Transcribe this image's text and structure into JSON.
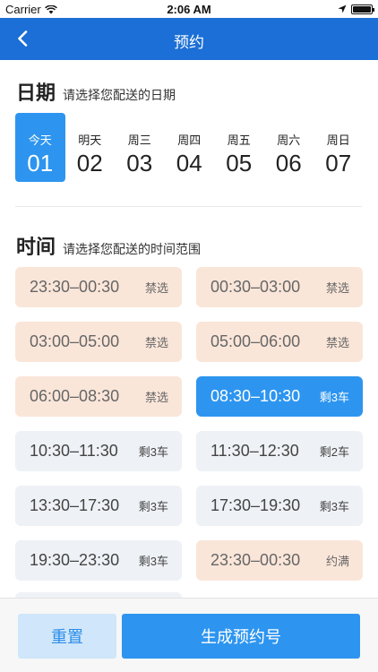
{
  "status_bar": {
    "carrier": "Carrier",
    "time": "2:06 AM"
  },
  "nav": {
    "title": "预约"
  },
  "date_section": {
    "title": "日期",
    "subtitle": "请选择您配送的日期",
    "dates": [
      {
        "label": "今天",
        "day": "01"
      },
      {
        "label": "明天",
        "day": "02"
      },
      {
        "label": "周三",
        "day": "03"
      },
      {
        "label": "周四",
        "day": "04"
      },
      {
        "label": "周五",
        "day": "05"
      },
      {
        "label": "周六",
        "day": "06"
      },
      {
        "label": "周日",
        "day": "07"
      }
    ]
  },
  "time_section": {
    "title": "时间",
    "subtitle": "请选择您配送的时间范围",
    "slots": [
      {
        "time": "23:30–00:30",
        "status": "禁选"
      },
      {
        "time": "00:30–03:00",
        "status": "禁选"
      },
      {
        "time": "03:00–05:00",
        "status": "禁选"
      },
      {
        "time": "05:00–06:00",
        "status": "禁选"
      },
      {
        "time": "06:00–08:30",
        "status": "禁选"
      },
      {
        "time": "08:30–10:30",
        "status": "剩3车"
      },
      {
        "time": "10:30–11:30",
        "status": "剩3车"
      },
      {
        "time": "11:30–12:30",
        "status": "剩2车"
      },
      {
        "time": "13:30–17:30",
        "status": "剩3车"
      },
      {
        "time": "17:30–19:30",
        "status": "剩3车"
      },
      {
        "time": "19:30–23:30",
        "status": "剩3车"
      },
      {
        "time": "23:30–00:30",
        "status": "约满"
      }
    ]
  },
  "footer": {
    "reset_label": "重置",
    "generate_label": "生成预约号"
  }
}
